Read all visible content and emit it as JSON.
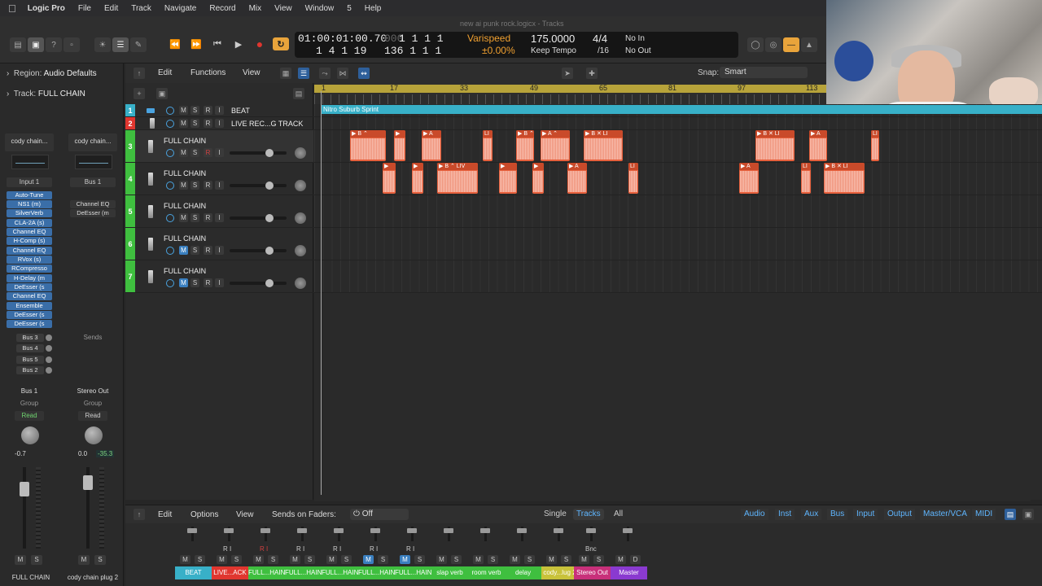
{
  "menubar": {
    "app": "Logic Pro",
    "items": [
      "File",
      "Edit",
      "Track",
      "Navigate",
      "Record",
      "Mix",
      "View",
      "Window",
      "5",
      "Help"
    ]
  },
  "window_title": "new ai punk rock.logicx - Tracks",
  "lcd": {
    "time": "01:00:01:00.70",
    "pos_top": "1 1 1 1",
    "pos_bottom": "1 4 1 19",
    "pos_bottom2": "136 1 1 1",
    "varispeed_label": "Varispeed",
    "varispeed_value": "±0.00%",
    "tempo": "175.0000",
    "tempo_mode": "Keep Tempo",
    "signature": "4/4",
    "division": "/16",
    "midi_in": "No In",
    "midi_out": "No Out"
  },
  "inspector": {
    "region_label": "Region:",
    "region_value": "Audio Defaults",
    "track_label": "Track:",
    "track_value": "FULL CHAIN",
    "strip1": {
      "name": "cody chain...",
      "input": "Input 1",
      "plugins": [
        "Auto-Tune",
        "NS1 (m)",
        "SilverVerb",
        "CLA-2A (s)",
        "Channel EQ",
        "H-Comp (s)",
        "Channel EQ",
        "RVox (s)",
        "RCompresso",
        "H-Delay (m",
        "DeEsser (s",
        "Channel EQ",
        "Ensemble",
        "DeEsser (s",
        "DeEsser (s"
      ],
      "sends": [
        "Bus 3",
        "Bus 4",
        "Bus 5",
        "Bus 2"
      ],
      "output": "Bus 1",
      "group": "Group",
      "automation": "Read",
      "volume": "-0.7",
      "footer": "FULL CHAIN"
    },
    "strip2": {
      "name": "cody chain...",
      "input": "Bus 1",
      "plugins": [
        "Channel EQ",
        "DeEsser (m"
      ],
      "sends_label": "Sends",
      "output": "Stereo Out",
      "group": "Group",
      "automation": "Read",
      "volume": "0.0",
      "peak": "-35.3",
      "footer": "cody chain plug 2"
    }
  },
  "tracks_toolbar": {
    "edit": "Edit",
    "functions": "Functions",
    "view": "View",
    "snap_label": "Snap:",
    "snap_value": "Smart"
  },
  "ruler": {
    "bars": [
      "1",
      "17",
      "33",
      "49",
      "65",
      "81",
      "97",
      "113"
    ]
  },
  "tracks": [
    {
      "num": "1",
      "name": "BEAT",
      "color": "#38b0c8"
    },
    {
      "num": "2",
      "name": "LIVE REC...G TRACK",
      "color": "#e0362f"
    },
    {
      "num": "3",
      "name": "FULL CHAIN",
      "color": "#3fbf3f"
    },
    {
      "num": "4",
      "name": "FULL CHAIN",
      "color": "#3fbf3f"
    },
    {
      "num": "5",
      "name": "FULL CHAIN",
      "color": "#3fbf3f"
    },
    {
      "num": "6",
      "name": "FULL CHAIN",
      "color": "#3fbf3f"
    },
    {
      "num": "7",
      "name": "FULL CHAIN",
      "color": "#3fbf3f"
    }
  ],
  "beat_region": "Nitro Suburb Sprint",
  "region_labels": {
    "b": "▶ B ⌃",
    "a": "▶ A",
    "li": "LI",
    "bli": "▶ B ✕ LI",
    "aa": "▶ A ⌃",
    "bliv": "▶ B ⌃ LIV",
    "p": "▶"
  },
  "mixer": {
    "edit": "Edit",
    "options": "Options",
    "view": "View",
    "sends_on_faders": "Sends on Faders:",
    "sends_value": "Off",
    "tabs": [
      "Single",
      "Tracks",
      "All"
    ],
    "filters": [
      "Audio",
      "Inst",
      "Aux",
      "Bus",
      "Input",
      "Output",
      "Master/VCA",
      "MIDI"
    ],
    "channels": [
      {
        "label": "BEAT",
        "color": "#38b0c8"
      },
      {
        "label": "LIVE...ACK",
        "color": "#e0362f"
      },
      {
        "label": "FULL...HAIN",
        "color": "#3fbf3f"
      },
      {
        "label": "FULL...HAIN",
        "color": "#3fbf3f"
      },
      {
        "label": "FULL...HAIN",
        "color": "#3fbf3f"
      },
      {
        "label": "FULL...HAIN",
        "color": "#3fbf3f"
      },
      {
        "label": "FULL...HAIN",
        "color": "#3fbf3f"
      },
      {
        "label": "slap verb",
        "color": "#3fbf3f"
      },
      {
        "label": "room verb",
        "color": "#3fbf3f"
      },
      {
        "label": "delay",
        "color": "#3fbf3f"
      },
      {
        "label": "cody...lug 2",
        "color": "#c8c23a"
      },
      {
        "label": "Stereo Out",
        "color": "#c8307a"
      },
      {
        "label": "Master",
        "color": "#8a3ad0"
      }
    ],
    "bnc": "Bnc"
  }
}
